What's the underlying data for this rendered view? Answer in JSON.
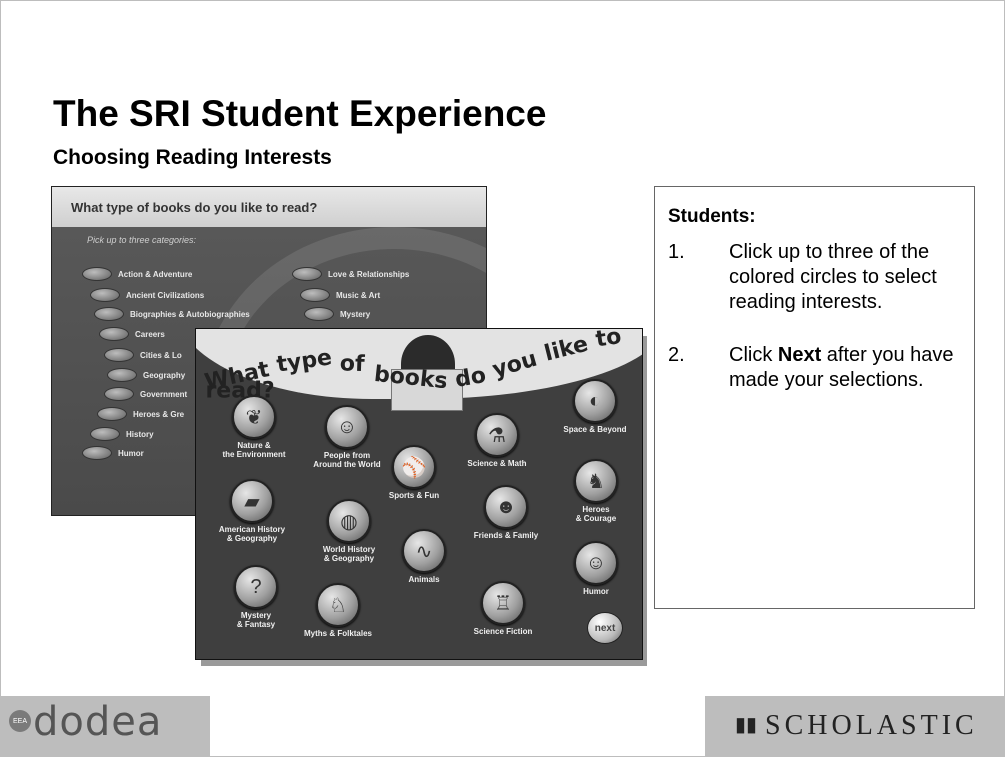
{
  "slide": {
    "title": "The SRI Student Experience",
    "subtitle": "Choosing Reading Interests"
  },
  "back_screen": {
    "question": "What type of books do you like to read?",
    "instruction": "Pick up to three categories:",
    "left_categories": [
      "Action & Adventure",
      "Ancient Civilizations",
      "Biographies & Autobiographies",
      "Careers",
      "Cities & Lo",
      "Geography",
      "Government",
      "Heroes & Gre",
      "History",
      "Humor"
    ],
    "right_categories": [
      "Love & Relationships",
      "Music & Art",
      "Mystery"
    ]
  },
  "front_screen": {
    "title_words": [
      "What",
      "type",
      "of",
      "books",
      "do",
      "you",
      "like",
      "to",
      "read?"
    ],
    "categories": [
      {
        "label": "Nature &\nthe Environment",
        "icon": "leaf-icon",
        "glyph": "❦"
      },
      {
        "label": "People from\nAround the World",
        "icon": "people-icon",
        "glyph": "☺"
      },
      {
        "label": "Science & Math",
        "icon": "microscope-icon",
        "glyph": "⚗"
      },
      {
        "label": "Space & Beyond",
        "icon": "planet-icon",
        "glyph": "◐"
      },
      {
        "label": "Sports & Fun",
        "icon": "baseball-player-icon",
        "glyph": "⚾"
      },
      {
        "label": "American History\n& Geography",
        "icon": "usa-map-icon",
        "glyph": "▰"
      },
      {
        "label": "World History\n& Geography",
        "icon": "world-map-icon",
        "glyph": "◍"
      },
      {
        "label": "Friends & Family",
        "icon": "family-icon",
        "glyph": "☻"
      },
      {
        "label": "Heroes\n& Courage",
        "icon": "horse-rider-icon",
        "glyph": "♞"
      },
      {
        "label": "Animals",
        "icon": "lizard-icon",
        "glyph": "∿"
      },
      {
        "label": "Humor",
        "icon": "mask-icon",
        "glyph": "☺"
      },
      {
        "label": "Mystery\n& Fantasy",
        "icon": "magnifier-question-icon",
        "glyph": "?"
      },
      {
        "label": "Myths & Folktales",
        "icon": "unicorn-icon",
        "glyph": "♘"
      },
      {
        "label": "Science Fiction",
        "icon": "robot-icon",
        "glyph": "♖"
      }
    ],
    "next_label": "next"
  },
  "students": {
    "heading": "Students:",
    "steps": [
      {
        "num": "1.",
        "text_before": "Click up to three of the colored circles to select reading interests.",
        "bold": "",
        "text_after": ""
      },
      {
        "num": "2.",
        "text_before": "Click ",
        "bold": "Next",
        "text_after": " after you have made your selections."
      }
    ]
  },
  "footer": {
    "left_logo_text": "dodea",
    "left_seal_text": "EEA",
    "right_logo_text": "SCHOLASTIC"
  }
}
